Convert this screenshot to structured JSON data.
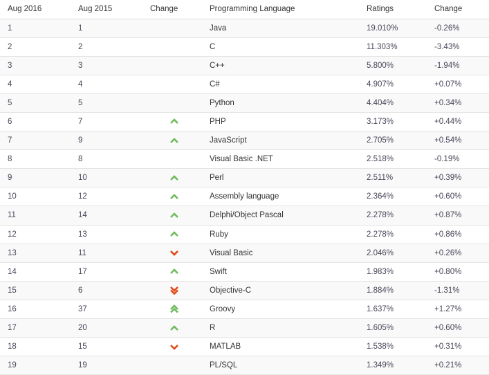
{
  "table": {
    "columns": [
      {
        "key": "rank_now",
        "label": "Aug 2016"
      },
      {
        "key": "rank_prev",
        "label": "Aug 2015"
      },
      {
        "key": "change",
        "label": "Change"
      },
      {
        "key": "language",
        "label": "Programming Language"
      },
      {
        "key": "ratings",
        "label": "Ratings"
      },
      {
        "key": "delta",
        "label": "Change"
      }
    ],
    "colors": {
      "row_shaded": "#f9f9f9",
      "row_plain": "#ffffff",
      "row_border": "#e4e4e4",
      "header_border": "#dddddd",
      "header_text": "#333333",
      "rank_text": "#4a4458",
      "language_text": "#333333",
      "chevron_up": "#6fbb5c",
      "chevron_down": "#e04a18"
    },
    "rows": [
      {
        "rank_now": "1",
        "rank_prev": "1",
        "change": "none",
        "language": "Java",
        "ratings": "19.010%",
        "delta": "-0.26%"
      },
      {
        "rank_now": "2",
        "rank_prev": "2",
        "change": "none",
        "language": "C",
        "ratings": "11.303%",
        "delta": "-3.43%"
      },
      {
        "rank_now": "3",
        "rank_prev": "3",
        "change": "none",
        "language": "C++",
        "ratings": "5.800%",
        "delta": "-1.94%"
      },
      {
        "rank_now": "4",
        "rank_prev": "4",
        "change": "none",
        "language": "C#",
        "ratings": "4.907%",
        "delta": "+0.07%"
      },
      {
        "rank_now": "5",
        "rank_prev": "5",
        "change": "none",
        "language": "Python",
        "ratings": "4.404%",
        "delta": "+0.34%"
      },
      {
        "rank_now": "6",
        "rank_prev": "7",
        "change": "up",
        "language": "PHP",
        "ratings": "3.173%",
        "delta": "+0.44%"
      },
      {
        "rank_now": "7",
        "rank_prev": "9",
        "change": "up",
        "language": "JavaScript",
        "ratings": "2.705%",
        "delta": "+0.54%"
      },
      {
        "rank_now": "8",
        "rank_prev": "8",
        "change": "none",
        "language": "Visual Basic .NET",
        "ratings": "2.518%",
        "delta": "-0.19%"
      },
      {
        "rank_now": "9",
        "rank_prev": "10",
        "change": "up",
        "language": "Perl",
        "ratings": "2.511%",
        "delta": "+0.39%"
      },
      {
        "rank_now": "10",
        "rank_prev": "12",
        "change": "up",
        "language": "Assembly language",
        "ratings": "2.364%",
        "delta": "+0.60%"
      },
      {
        "rank_now": "11",
        "rank_prev": "14",
        "change": "up",
        "language": "Delphi/Object Pascal",
        "ratings": "2.278%",
        "delta": "+0.87%"
      },
      {
        "rank_now": "12",
        "rank_prev": "13",
        "change": "up",
        "language": "Ruby",
        "ratings": "2.278%",
        "delta": "+0.86%"
      },
      {
        "rank_now": "13",
        "rank_prev": "11",
        "change": "down",
        "language": "Visual Basic",
        "ratings": "2.046%",
        "delta": "+0.26%"
      },
      {
        "rank_now": "14",
        "rank_prev": "17",
        "change": "up",
        "language": "Swift",
        "ratings": "1.983%",
        "delta": "+0.80%"
      },
      {
        "rank_now": "15",
        "rank_prev": "6",
        "change": "down-dbl",
        "language": "Objective-C",
        "ratings": "1.884%",
        "delta": "-1.31%"
      },
      {
        "rank_now": "16",
        "rank_prev": "37",
        "change": "up-dbl",
        "language": "Groovy",
        "ratings": "1.637%",
        "delta": "+1.27%"
      },
      {
        "rank_now": "17",
        "rank_prev": "20",
        "change": "up",
        "language": "R",
        "ratings": "1.605%",
        "delta": "+0.60%"
      },
      {
        "rank_now": "18",
        "rank_prev": "15",
        "change": "down",
        "language": "MATLAB",
        "ratings": "1.538%",
        "delta": "+0.31%"
      },
      {
        "rank_now": "19",
        "rank_prev": "19",
        "change": "none",
        "language": "PL/SQL",
        "ratings": "1.349%",
        "delta": "+0.21%"
      }
    ]
  },
  "icons": {
    "up": "chevron-up-icon",
    "down": "chevron-down-icon",
    "up-dbl": "double-chevron-up-icon",
    "down-dbl": "double-chevron-down-icon",
    "none": "no-change-icon"
  }
}
